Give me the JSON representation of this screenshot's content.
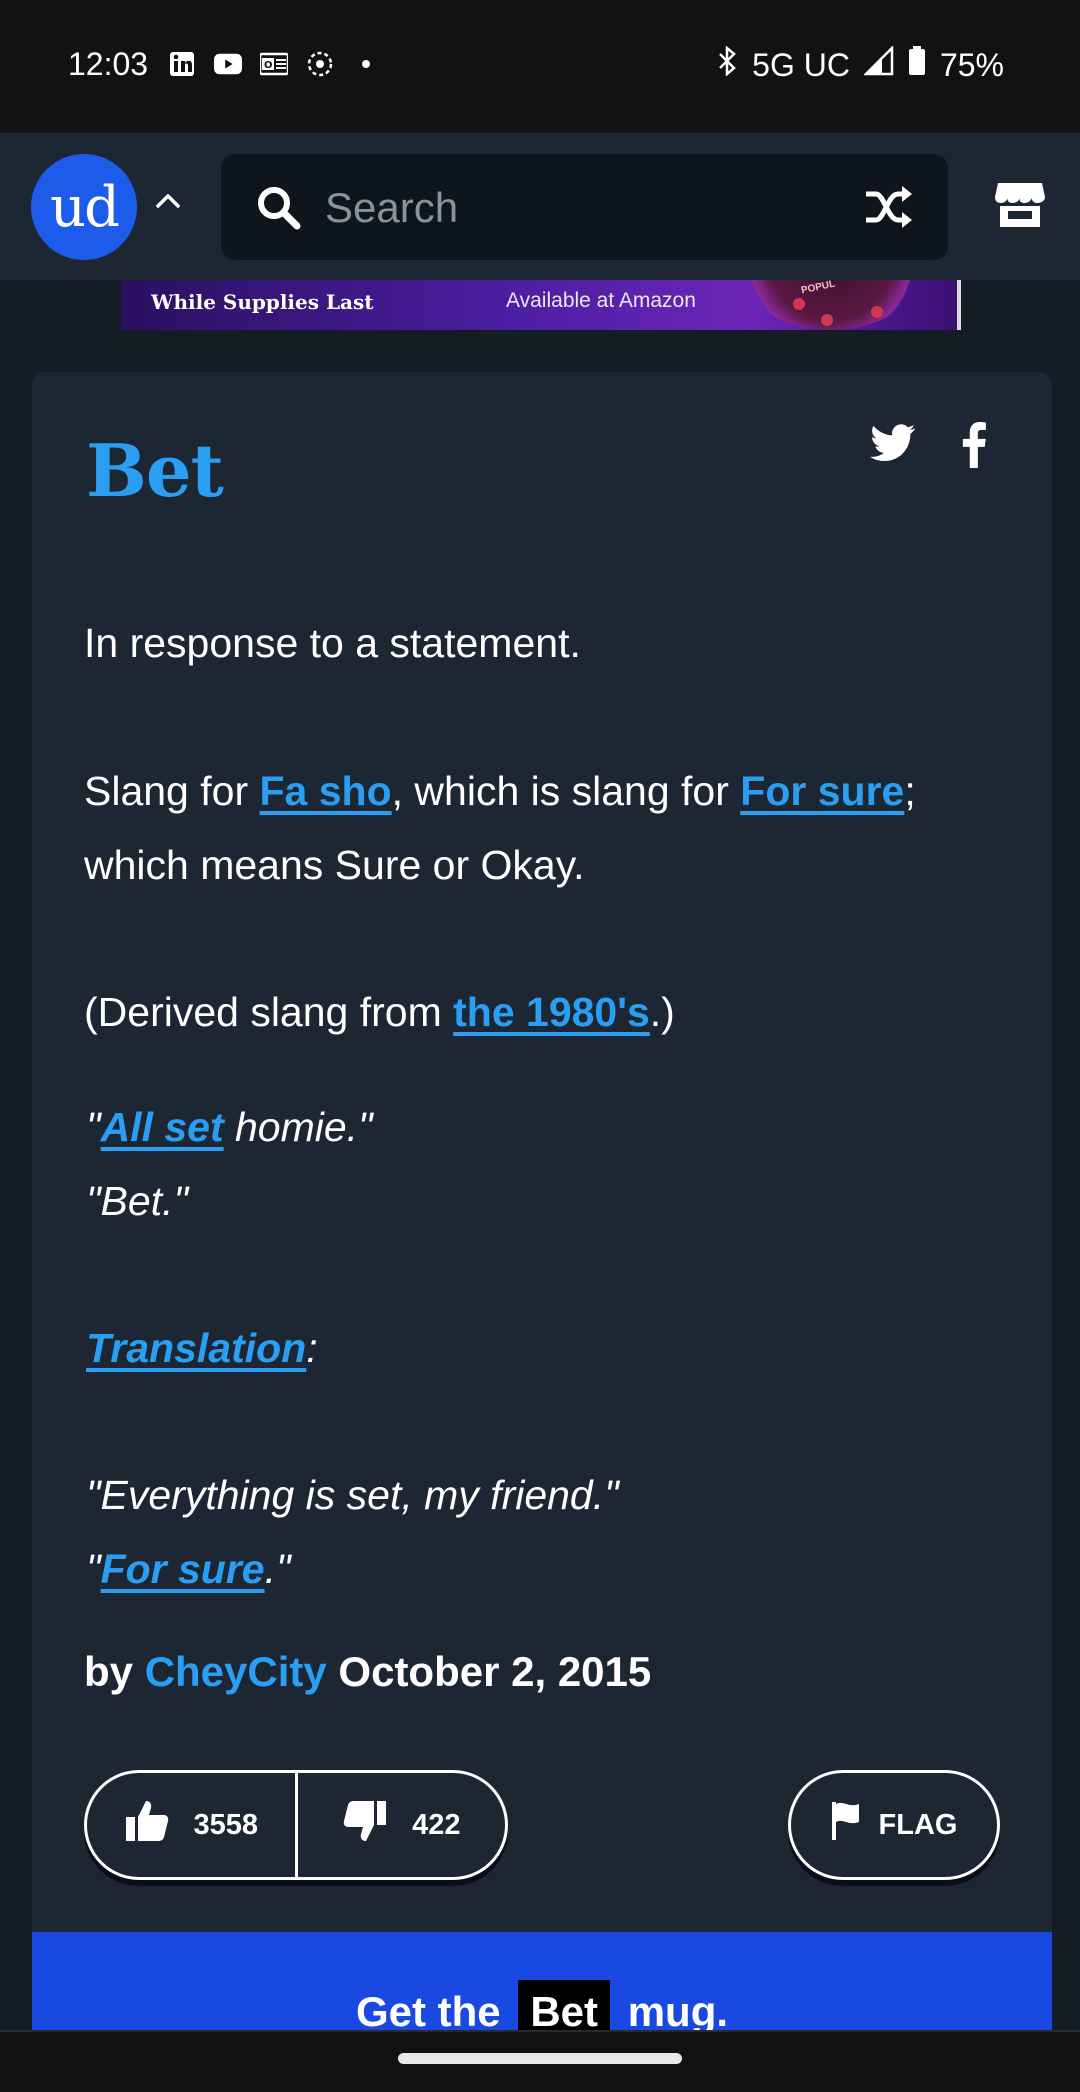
{
  "status_bar": {
    "time": "12:03",
    "network": "5G UC",
    "battery": "75%",
    "notification_icons": [
      "linkedin-icon",
      "youtube-icon",
      "outlook-icon",
      "settings-dot-icon",
      "dot-icon"
    ]
  },
  "header": {
    "logo_text": "ud",
    "search_placeholder": "Search"
  },
  "ad": {
    "left_text": "While Supplies Last",
    "middle_text": "Available at Amazon",
    "brand_fragment": "POPUL"
  },
  "entry": {
    "word": "Bet",
    "line1": "In response to a statement.",
    "line2_prefix": "Slang for ",
    "link_fa_sho": "Fa sho",
    "line2_mid": ", which is slang for ",
    "link_for_sure": "For sure",
    "line2_suffix": ";",
    "line3": "which means Sure or Okay.",
    "line4_prefix": "(Derived slang from ",
    "link_1980s": "the 1980's",
    "line4_suffix": ".)",
    "ex1_open": "\"",
    "ex1_link": "All set",
    "ex1_rest": " homie.\"",
    "ex2": "\"Bet.\"",
    "translation_link": "Translation",
    "translation_colon": ":",
    "ex3": "\"Everything is set, my friend.\"",
    "ex4_open": "\"",
    "ex4_link": "For sure",
    "ex4_rest": ".\"",
    "by_label": "by",
    "author": "CheyCity",
    "date": "October 2, 2015",
    "upvotes": "3558",
    "downvotes": "422",
    "flag_label": "FLAG",
    "mug_prefix": "Get the",
    "mug_word": "Bet",
    "mug_suffix": "mug."
  },
  "colors": {
    "accent": "#2a9ef2",
    "card_bg": "#1c2733",
    "page_bg": "#141c25",
    "logo_bg": "#1d5bea",
    "mug_banner": "#1a49e2"
  }
}
